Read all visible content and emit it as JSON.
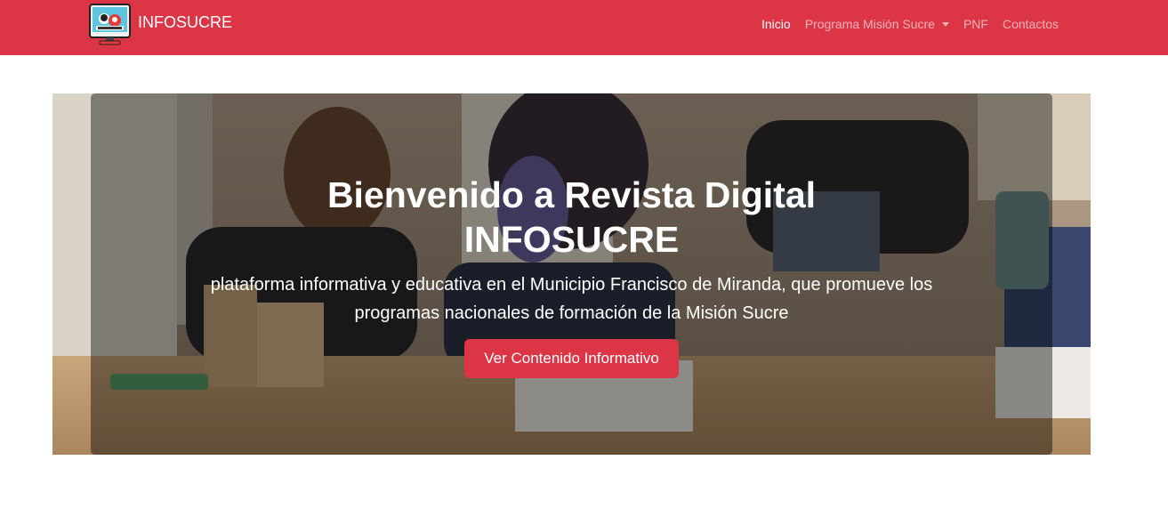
{
  "navbar": {
    "brand_text": "INFOSUCRE",
    "brand_logo_icon": "computer-monitor-logo-icon",
    "background_color": "#dc3545",
    "items": [
      {
        "label": "Inicio",
        "active": true
      },
      {
        "label": "Programa Misión Sucre",
        "dropdown": true,
        "icon": "caret-down-icon"
      },
      {
        "label": "PNF"
      },
      {
        "label": "Contactos"
      }
    ]
  },
  "hero": {
    "title_line1": "Bienvenido a Revista Digital",
    "title_line2": "INFOSUCRE",
    "lead_line1": "plataforma informativa y educativa en el Municipio Francisco de Miranda, que promueve los",
    "lead_line2": "programas nacionales de formación de la Misión Sucre",
    "button_label": "Ver Contenido Informativo",
    "button_color": "#dc3545"
  }
}
